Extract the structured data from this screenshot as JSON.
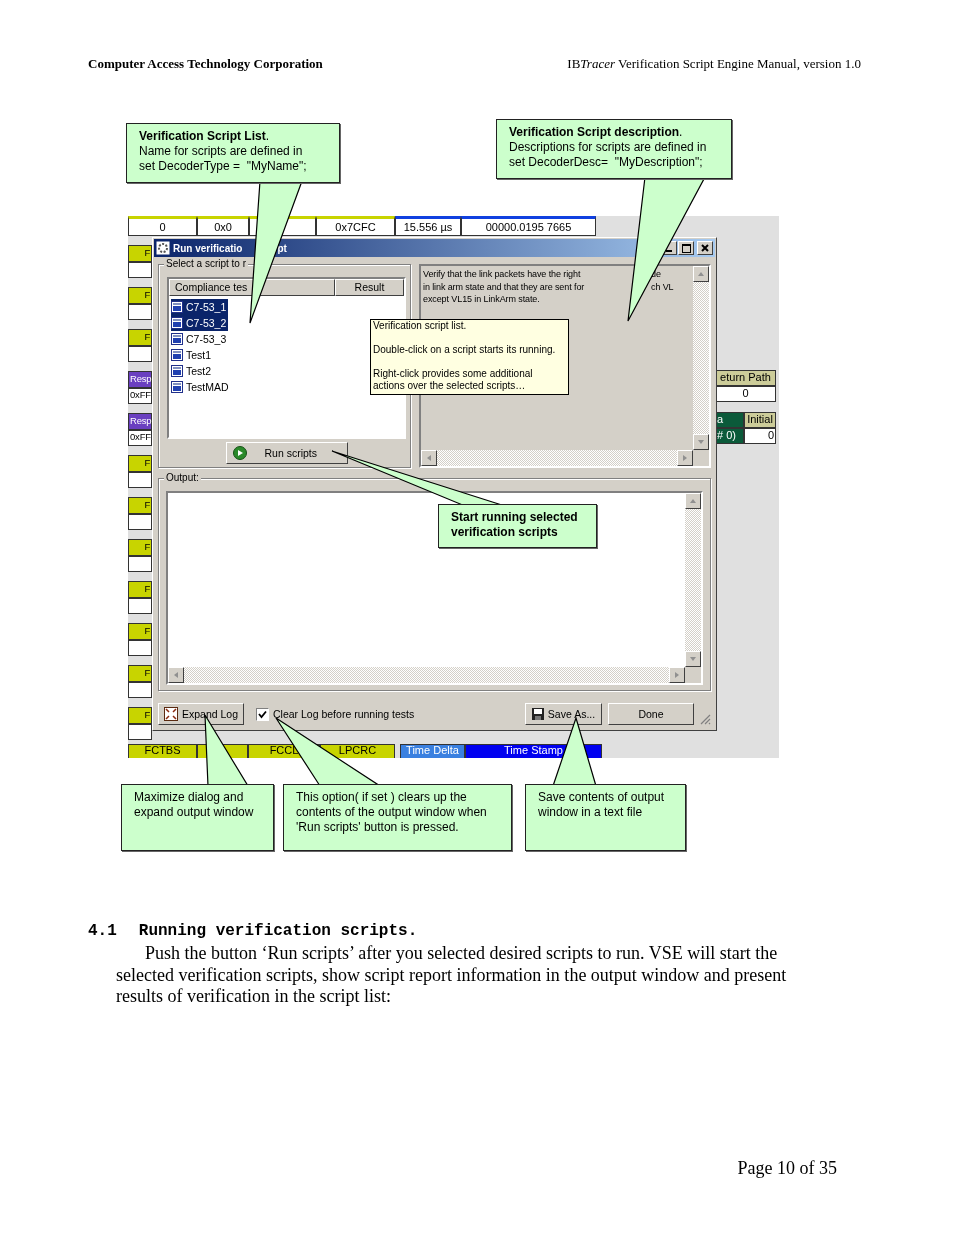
{
  "header": {
    "left": "Computer Access Technology Corporation",
    "right": {
      "prefix": "IB",
      "brand": "Tracer",
      "title": "Verification Script Engine Manual, version 1.0"
    }
  },
  "figure": {
    "trace": {
      "top_row": [
        {
          "text": "0",
          "color": "#c8d400"
        },
        {
          "text": "0x0",
          "color": "#c8d400"
        },
        {
          "color": "#c8d400"
        },
        {
          "text": "0x7CFC",
          "color": "#c8d400"
        },
        {
          "text": "15.556 µs",
          "color": "#1040e0"
        },
        {
          "text": "00000.0195 7665",
          "color": "#1040e0"
        }
      ],
      "left_rows": [
        {
          "kind": "frame",
          "label": "F"
        },
        {
          "kind": "frame",
          "label": "F"
        },
        {
          "kind": "frame",
          "label": "F"
        },
        {
          "kind": "response",
          "label": "Resp",
          "value": "0xFF"
        },
        {
          "kind": "response",
          "label": "Resp",
          "value": "0xFF"
        },
        {
          "kind": "frame",
          "label": "F"
        },
        {
          "kind": "frame",
          "label": "F"
        },
        {
          "kind": "frame",
          "label": "F"
        },
        {
          "kind": "frame",
          "label": "F"
        },
        {
          "kind": "frame",
          "label": "F"
        },
        {
          "kind": "frame",
          "label": "F"
        },
        {
          "kind": "frame",
          "label": "F"
        }
      ],
      "right_panel": [
        {
          "cells": [
            {
              "text": "eturn Path",
              "color": "#cccc99"
            }
          ]
        },
        {
          "cells": [
            {
              "text": "0",
              "color": "#ffffff"
            }
          ]
        },
        {
          "cells": [
            {
              "text": "a",
              "color": "#0b5a3a"
            },
            {
              "text": "Initial",
              "color": "#cccc99"
            }
          ]
        },
        {
          "cells": [
            {
              "text": "# 0)",
              "color": "#0b5a3a"
            },
            {
              "text": "0",
              "color": "#ffffff"
            }
          ]
        }
      ],
      "bottom_row": [
        {
          "text": "FCTBS",
          "color": "#c8d400"
        },
        {
          "color": "#c8d400"
        },
        {
          "text": "FCCL",
          "color": "#c8d400"
        },
        {
          "text": "LPCRC",
          "color": "#c8d400"
        },
        {
          "text": "Time Delta",
          "color": "#3a80e0"
        },
        {
          "text": "Time Stamp",
          "color": "#0000f0"
        }
      ]
    },
    "dialog": {
      "title_parts": [
        "Run verificatio",
        "pt"
      ],
      "script_group": {
        "label": "Select a script to r",
        "columns": [
          "Compliance tes",
          "Result"
        ],
        "items": [
          {
            "name": "C7-53_1",
            "selected": true
          },
          {
            "name": "C7-53_2",
            "selected": true
          },
          {
            "name": "C7-53_3",
            "selected": false
          },
          {
            "name": "Test1",
            "selected": false
          },
          {
            "name": "Test2",
            "selected": false
          },
          {
            "name": "TestMAD",
            "selected": false
          }
        ],
        "run_button": "Run scripts"
      },
      "description": {
        "lines": [
          [
            "Verify that the link packets have the right",
            "de"
          ],
          [
            "in link arm state and that they are sent for",
            "ch VL"
          ],
          [
            "except VL15 in LinkArm state."
          ]
        ]
      },
      "tooltip": {
        "lines": [
          "Verification script list.",
          "Double-click on a script starts its running.",
          "Right-click provides some additional actions over the selected scripts…"
        ]
      },
      "output": {
        "label": "Output:"
      },
      "expand_button": "Expand Log",
      "clear_log": {
        "label": "Clear Log before running tests",
        "checked": true
      },
      "save_button": "Save As...",
      "done_button": "Done"
    },
    "callouts": [
      {
        "lines": [
          "**Verification Script List**.",
          "Name for scripts are defined in",
          "set DecoderType =  \"MyName\";"
        ],
        "bold": false
      },
      {
        "lines": [
          "**Verification Script description**.",
          "Descriptions for scripts are defined in",
          "set DecoderDesc=  \"MyDescription\";"
        ],
        "bold": false
      },
      {
        "lines": [
          "Start running selected",
          "verification scripts"
        ],
        "bold": true
      },
      {
        "lines": [
          "Maximize dialog and",
          "expand output window"
        ],
        "bold": false
      },
      {
        "lines": [
          "This option( if set ) clears up the",
          "contents of the output window when",
          "'Run scripts' button is pressed."
        ],
        "bold": false
      },
      {
        "lines": [
          "Save contents of output",
          "window in a text file"
        ],
        "bold": false
      }
    ]
  },
  "section": {
    "number": "4.1",
    "title": "Running verification scripts."
  },
  "paragraph": "Push the button ‘Run scripts’ after you selected desired scripts to run. VSE will start the selected verification scripts, show script report information in the output window and present results of verification in the script list:",
  "footer": "Page 10 of 35"
}
